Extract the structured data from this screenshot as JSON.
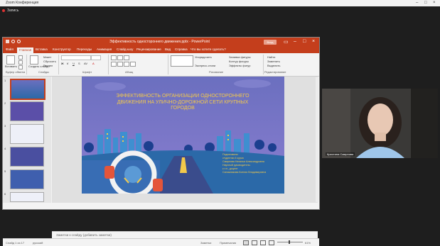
{
  "conference": {
    "title": "Zoom Конференция",
    "subtitle": "Запись",
    "controls": [
      "–",
      "□",
      "×"
    ]
  },
  "ppt": {
    "window_title": "Эффективность одностороннего движения.pptx - PowerPoint",
    "sign_in": "Вход",
    "tabs": [
      "Файл",
      "Главная",
      "Вставка",
      "Конструктор",
      "Переходы",
      "Анимация",
      "Слайд-шоу",
      "Рецензирование",
      "Вид",
      "Справка",
      "Что вы хотите сделать?"
    ],
    "active_tab": "Главная",
    "ribbon": {
      "paste": "Вставить",
      "create_slide": "Создать слайд",
      "reset": "Сбросить",
      "section": "Раздел",
      "groups": [
        "Буфер обмена",
        "Слайды",
        "Шрифт",
        "Абзац",
        "Рисование",
        "Редактирование"
      ],
      "shapes": "Фигуры",
      "arrange": "Упорядочить",
      "quick_styles": "Экспресс-стили",
      "fill": "Заливка фигуры",
      "outline": "Контур фигуры",
      "effects": "Эффекты фигур",
      "find": "Найти",
      "replace": "Заменить",
      "select": "Выделить"
    },
    "thumb_numbers": [
      "1",
      "2",
      "3",
      "4",
      "5",
      "6"
    ],
    "notes_placeholder": "Заметки к слайду (добавить заметки)",
    "status": {
      "slide": "Слайд 1 из 17",
      "lang": "русский",
      "notes": "Заметки",
      "comments": "Примечания",
      "zoom": "61%"
    }
  },
  "slide": {
    "title": "ЭФФЕКТИВНОСТЬ ОРГАНИЗАЦИИ ОДНОСТОРОННЕГО ДВИЖЕНИЯ НА УЛИЧНО-ДОРОЖНОЙ СЕТИ КРУПНЫХ ГОРОДОВ",
    "prepared_by": [
      "Подготовили:",
      "студентки 4 курса",
      "Смирнова Наталья Александровна",
      "Научный руководитель:",
      "к.т.н., доцент",
      "Сапожникова Ксения Владимировна"
    ],
    "colors": {
      "sky_top": "#6b6fbf",
      "sky_bottom": "#8a7ed0",
      "title": "#f3c94a",
      "ground": "#2b69a8",
      "road": "#3a4c8c",
      "trees": "#1c3f8f",
      "accent": "#c43e1c"
    }
  },
  "webcam": {
    "name": "Кристина Смирнова"
  }
}
